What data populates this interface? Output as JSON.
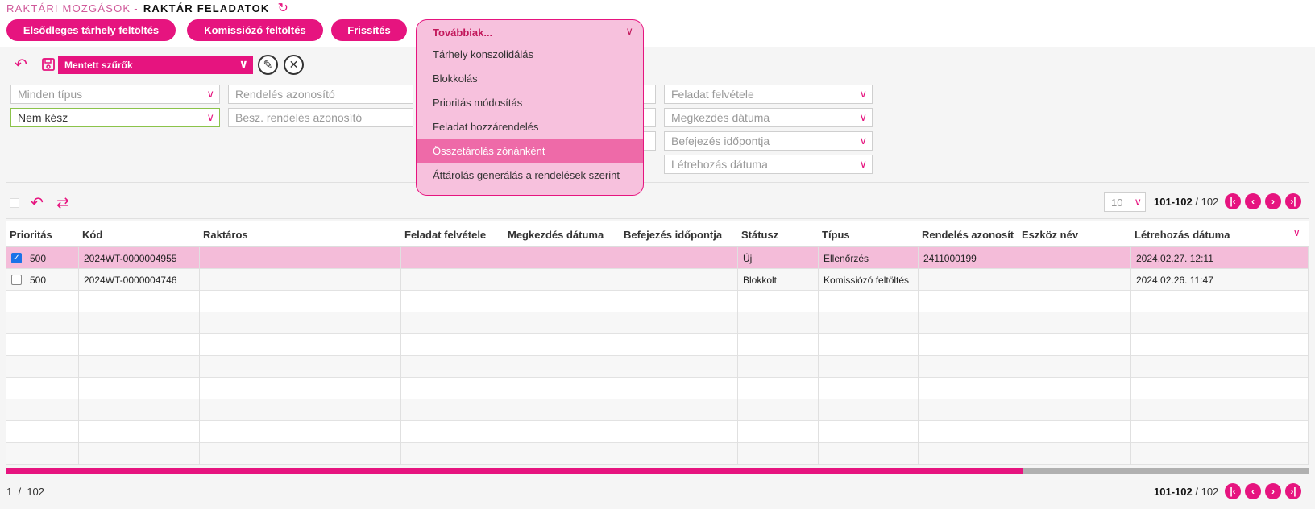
{
  "header": {
    "parent": "RAKTÁRI MOZGÁSOK",
    "separator": "-",
    "current": "RAKTÁR FELADATOK"
  },
  "actions": {
    "primary_fill": "Elsődleges tárhely feltöltés",
    "picker_fill": "Komissiózó feltöltés",
    "refresh": "Frissítés",
    "more": "Továbbiak..."
  },
  "more_menu": [
    "Tárhely konszolidálás",
    "Blokkolás",
    "Prioritás módosítás",
    "Feladat hozzárendelés",
    "Összetárolás zónánként",
    "Áttárolás generálás a rendelések szerint"
  ],
  "filters": {
    "saved_filters": "Mentett szűrők",
    "type_placeholder": "Minden típus",
    "status_value": "Nem kész",
    "order_id_placeholder": "Rendelés azonosító",
    "purchase_order_placeholder": "Besz. rendelés azonosító",
    "task_received_placeholder": "Feladat felvétele",
    "start_date_placeholder": "Megkezdés dátuma",
    "end_time_placeholder": "Befejezés időpontja",
    "created_date_placeholder": "Létrehozás dátuma"
  },
  "pagination": {
    "per_page": "10",
    "range": "101-102",
    "sep": "/",
    "total": "102",
    "footer_page": "1",
    "footer_sep": "/",
    "footer_total": "102"
  },
  "table": {
    "columns": [
      "Prioritás",
      "Kód",
      "Raktáros",
      "Feladat felvétele",
      "Megkezdés dátuma",
      "Befejezés időpontja",
      "Státusz",
      "Típus",
      "Rendelés azonosít",
      "Eszköz név",
      "Létrehozás dátuma"
    ],
    "rows": [
      {
        "checked": true,
        "priority": "500",
        "code": "2024WT-0000004955",
        "warehouseman": "",
        "task_received": "",
        "start_date": "",
        "end_time": "",
        "status": "Új",
        "type": "Ellenőrzés",
        "order_id": "2411000199",
        "device": "",
        "created": "2024.02.27. 12:11"
      },
      {
        "checked": false,
        "priority": "500",
        "code": "2024WT-0000004746",
        "warehouseman": "",
        "task_received": "",
        "start_date": "",
        "end_time": "",
        "status": "Blokkolt",
        "type": "Komissiózó feltöltés",
        "order_id": "",
        "device": "",
        "created": "2024.02.26. 11:47"
      }
    ]
  },
  "scroll": {
    "horizontal_position": 0.78
  },
  "colors": {
    "accent": "#e6147f",
    "selected_row": "#f4bcd9",
    "menu_bg": "#f7c1dd",
    "menu_hover": "#ee6aa8"
  },
  "icons": [
    "refresh-icon",
    "undo-icon",
    "save-icon",
    "pencil-icon",
    "close-icon",
    "swap-icon",
    "chevron-down-icon",
    "first-page-icon",
    "prev-page-icon",
    "next-page-icon",
    "last-page-icon"
  ]
}
